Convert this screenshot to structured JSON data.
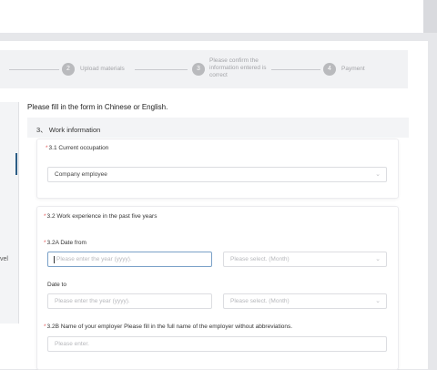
{
  "steps": [
    {
      "number": "2",
      "label": "Upload materials"
    },
    {
      "number": "3",
      "label": "Please confirm the information entered is correct"
    },
    {
      "number": "4",
      "label": "Payment"
    }
  ],
  "sidebar": {
    "partial_text": "vel"
  },
  "instruction": "Please fill in the form in Chinese or English.",
  "section": {
    "title": "3、 Work information"
  },
  "occupation": {
    "required_mark": "*",
    "label": "3.1 Current occupation",
    "value": "Company employee"
  },
  "experience": {
    "required_mark": "*",
    "label": "3.2 Work experience in the past five years",
    "date_from": {
      "required_mark": "*",
      "label": "3.2A Date from",
      "year_placeholder": "Please enter the year (yyyy).",
      "month_placeholder": "Please select. (Month)"
    },
    "date_to": {
      "label": "Date to",
      "year_placeholder": "Please enter the year (yyyy).",
      "month_placeholder": "Please select. (Month)"
    },
    "employer": {
      "required_mark": "*",
      "label": "3.2B Name of your employer  Please fill in the full name of the employer without abbreviations.",
      "placeholder": "Please enter."
    }
  },
  "colors": {
    "accent": "#2b5d85",
    "required": "#e45c5c",
    "active_border": "#7aa1c8"
  },
  "icons": {
    "dropdown": "chevron-down-icon"
  }
}
